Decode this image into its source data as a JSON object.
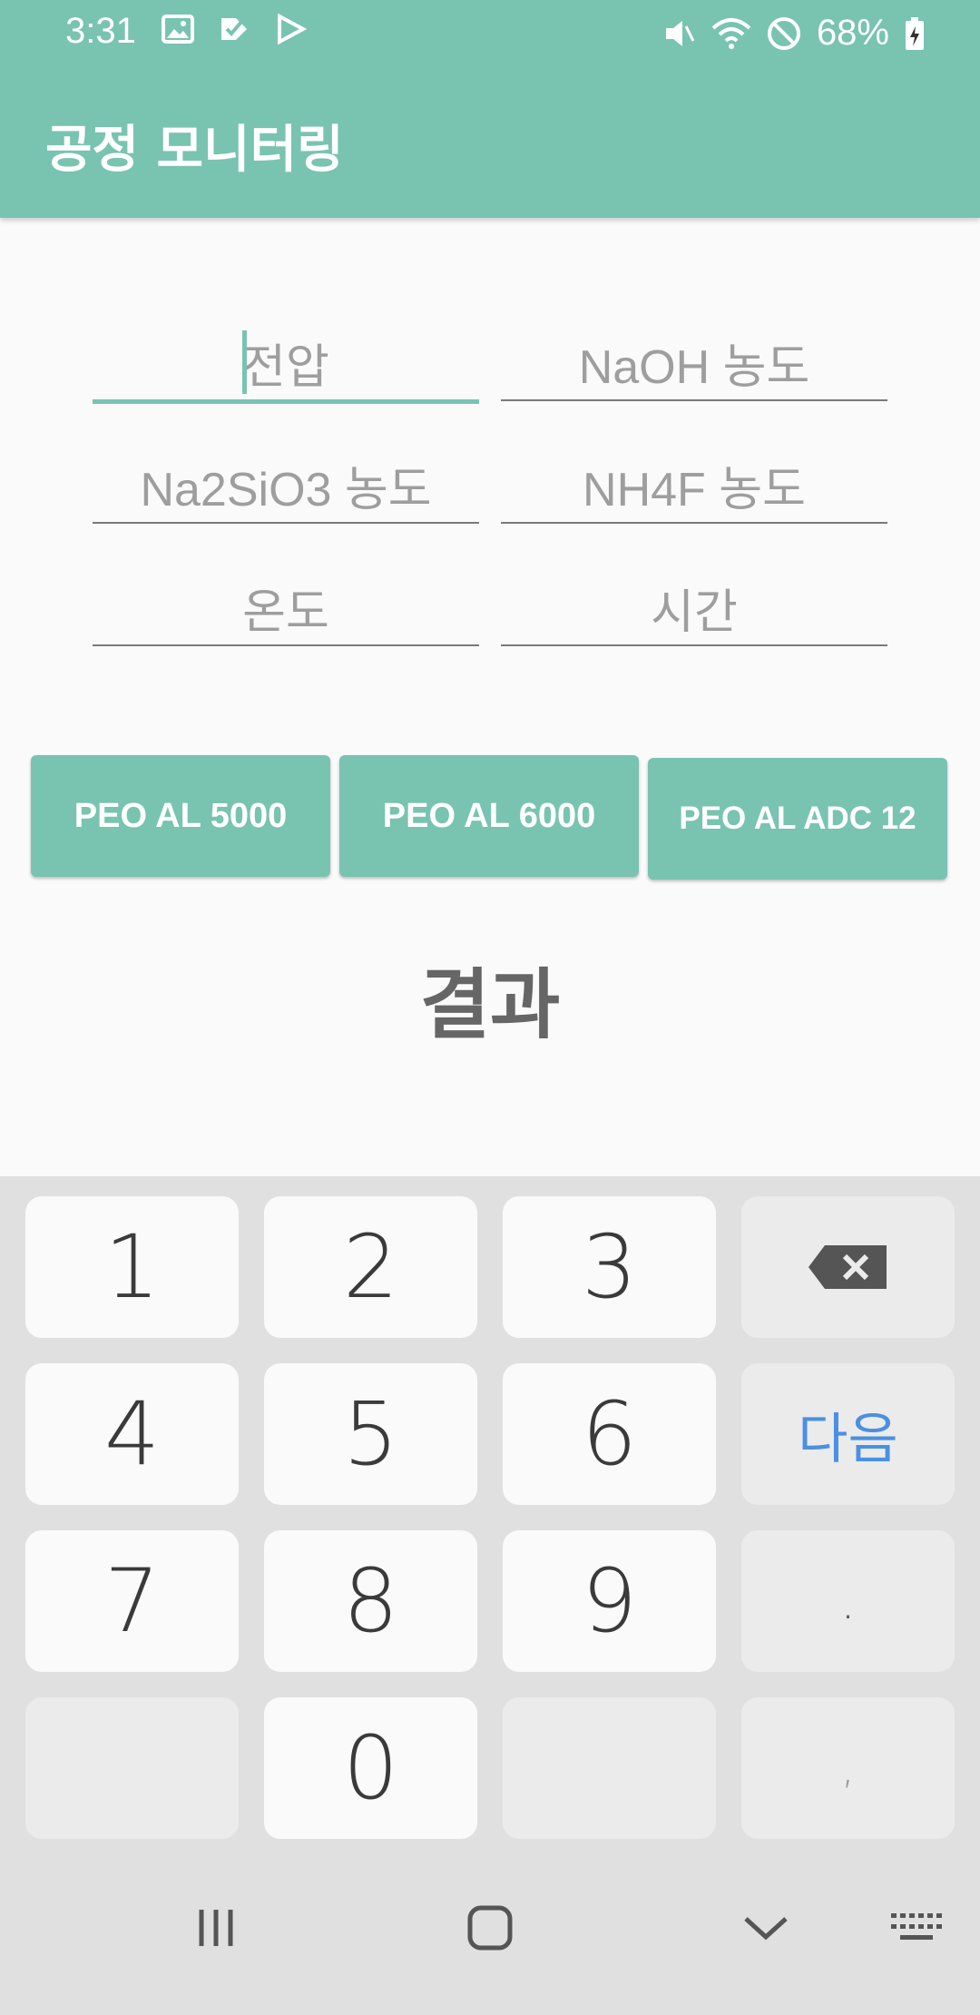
{
  "status_bar": {
    "time": "3:31",
    "battery": "68%",
    "left_icons": [
      "image-icon",
      "task-icon",
      "play-store-icon"
    ],
    "right_icons": [
      "mute-icon",
      "wifi-icon",
      "blocked-icon",
      "battery-icon"
    ]
  },
  "app": {
    "title": "공정 모니터링",
    "accent": "#79c3b1"
  },
  "inputs": [
    {
      "name": "voltage",
      "placeholder": "전압",
      "focused": true
    },
    {
      "name": "naoh",
      "placeholder": "NaOH 농도"
    },
    {
      "name": "na2sio3",
      "placeholder": "Na2SiO3 농도"
    },
    {
      "name": "nh4f",
      "placeholder": "NH4F 농도"
    },
    {
      "name": "temperature",
      "placeholder": "온도"
    },
    {
      "name": "time",
      "placeholder": "시간"
    }
  ],
  "buttons": [
    "PEO AL 5000",
    "PEO AL 6000",
    "PEO AL ADC 12"
  ],
  "result_label": "결과",
  "keyboard": {
    "rows": [
      [
        "1",
        "2",
        "3",
        "backspace"
      ],
      [
        "4",
        "5",
        "6",
        "다음"
      ],
      [
        "7",
        "8",
        "9",
        "."
      ],
      [
        "",
        "0",
        "",
        ","
      ]
    ],
    "next_label": "다음",
    "next_color": "#4a90e2"
  },
  "nav_bar": {
    "icons": [
      "recent-apps-icon",
      "home-icon",
      "back-icon",
      "keyboard-switch-icon"
    ]
  }
}
